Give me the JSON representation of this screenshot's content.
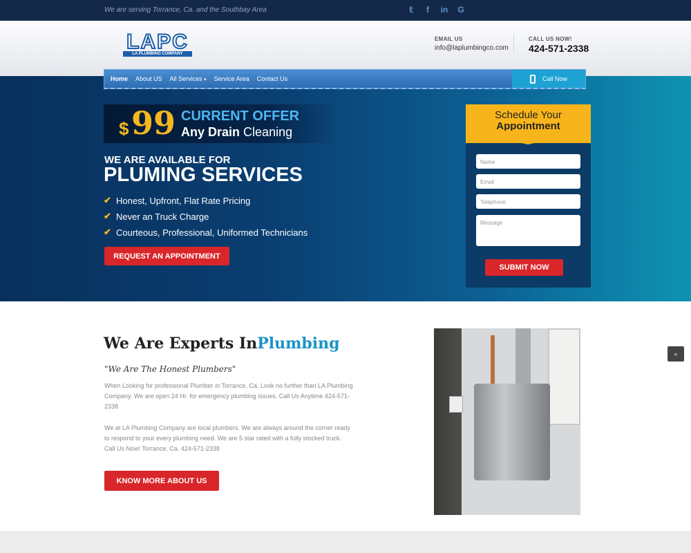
{
  "topbar": {
    "tagline": "We are serving Torrance, Ca. and the Southbay Area",
    "social": [
      {
        "icon": "twitter-icon",
        "glyph": "𝕥"
      },
      {
        "icon": "facebook-icon",
        "glyph": "f"
      },
      {
        "icon": "linkedin-icon",
        "glyph": "in"
      },
      {
        "icon": "google-icon",
        "glyph": "G"
      }
    ]
  },
  "header": {
    "logo_text": "LAPC",
    "logo_subtext": "LA PLUMBING COMPANY",
    "email_label": "EMAIL US",
    "email_value": "info@laplumbingco.com",
    "phone_label": "CALL US NOW!",
    "phone_value": "424-571-2338"
  },
  "nav": {
    "items": [
      "Home",
      "About US",
      "All Services",
      "Service Area",
      "Contact Us"
    ],
    "active": "Home",
    "call_now": "Call Now"
  },
  "hero": {
    "offer_dollar": "$",
    "offer_price": "99",
    "offer_current": "CURRENT OFFER",
    "offer_any_drain": "Any Drain",
    "offer_cleaning": "Cleaning",
    "available": "WE ARE AVAILABLE FOR",
    "pluming": "PLUMING SERVICES",
    "checks": [
      "Honest, Upfront, Flat Rate Pricing",
      "Never an Truck Charge",
      "Courteous, Professional, Uniformed Technicians"
    ],
    "request_button": "REQUEST AN APPOINTMENT"
  },
  "form": {
    "title_line1": "Schedule Your",
    "title_line2": "Appointment",
    "name_placeholder": "Name",
    "email_placeholder": "Email",
    "telephone_placeholder": "Telephone",
    "message_placeholder": "Message",
    "submit": "SUBMIT NOW"
  },
  "about": {
    "heading": "We Are Experts In",
    "heading_highlight": "Plumbing",
    "subheading": "\"We Are The Honest Plumbers\"",
    "para1": "When Looking for professional Plumber in Torrance, Ca. Look no further than LA Plumbing Company. We are open 24 Hr. for emergency plumbing issues. Call Us Anytime 424-571-2338",
    "para2": "We at LA Plumbing Company are local plumbers. We are always around the corner ready to respond to your every plumbing need. We are 5 star rated with a fully stocked truck. Call Us Now! Torrance, Ca. 424-571-2338",
    "button": "KNOW MORE ABOUT US"
  },
  "scroll_top": "«",
  "colors": {
    "accent_red": "#d9262a",
    "accent_gold": "#f4b81e",
    "accent_blue": "#1a92c7",
    "navy": "#14294a"
  }
}
